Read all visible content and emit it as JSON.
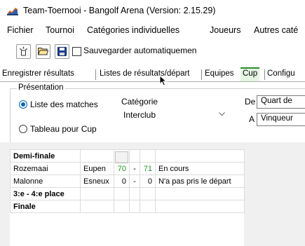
{
  "window": {
    "title": "Team-Toernooi - Bangolf Arena (Version: 2.15.29)",
    "icon": "chart-app-icon"
  },
  "menu": [
    "Fichier",
    "Tournoi",
    "Catégories individuelles",
    "Joueurs",
    "Autres caté"
  ],
  "toolbar": {
    "buttons": [
      "new-icon",
      "open-folder-icon",
      "save-icon"
    ],
    "autosave_label": "Sauvegarder automatiquemen",
    "autosave_checked": false
  },
  "tabs": [
    "Enregistrer résultats",
    "Listes de résultats/départ",
    "Equipes",
    "Cup",
    "Configu"
  ],
  "active_tab": "Cup",
  "presentation": {
    "legend": "Présentation",
    "options": [
      "Liste des matches",
      "Tableau pour Cup"
    ],
    "selected": "Liste des matches"
  },
  "category": {
    "label": "Catégorie",
    "value": "Interclub"
  },
  "range": {
    "from_label": "De",
    "from_value": "Quart de",
    "to_label": "A",
    "to_value": "Vinqueur"
  },
  "table": {
    "sections": [
      {
        "name": "Demi-finale",
        "rows": [
          {
            "team1": "Rozemaai",
            "team2": "Eupen",
            "score1": "70",
            "sep": "-",
            "score2": "71",
            "status": "En cours"
          },
          {
            "team1": "Malonne",
            "team2": "Esneux",
            "score1": "0",
            "sep": "-",
            "score2": "0",
            "status": "N'a pas pris le départ"
          }
        ]
      },
      {
        "name": "3:e - 4:e place",
        "rows": []
      },
      {
        "name": "Finale",
        "rows": []
      }
    ]
  },
  "colors": {
    "active_tab_bg": "#e3f5e3",
    "score_green": "#1a9a1a",
    "radio_blue": "#0067c0"
  }
}
